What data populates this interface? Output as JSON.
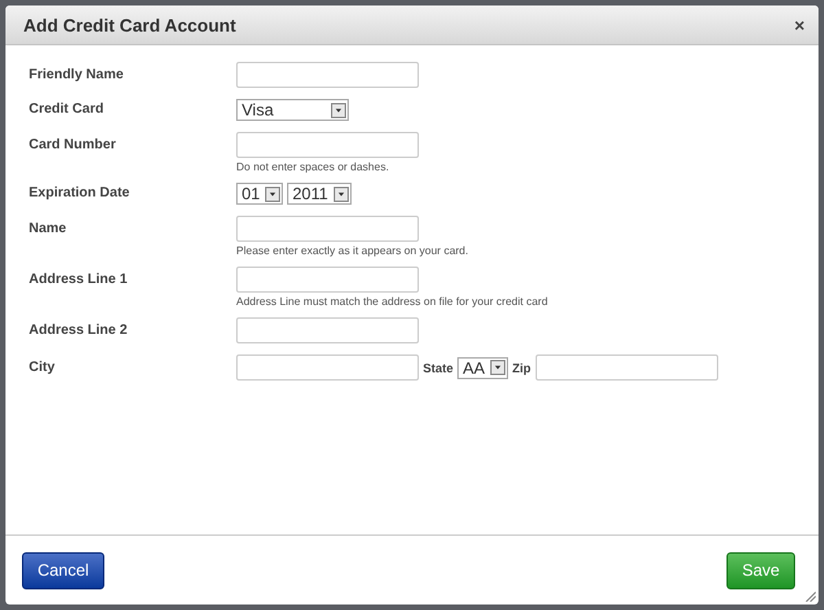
{
  "dialog": {
    "title": "Add Credit Card Account",
    "close": "×"
  },
  "fields": [
    {
      "kind": "text",
      "label": "Friendly Name"
    },
    {
      "kind": "select",
      "label": "Credit Card",
      "value": "Visa"
    },
    {
      "kind": "text",
      "label": "Card Number",
      "hint": "Do not enter spaces or dashes."
    },
    {
      "kind": "date",
      "label": "Expiration Date",
      "month": "01",
      "year": "2011"
    },
    {
      "kind": "text",
      "label": "Name",
      "hint": "Please enter exactly as it appears on your card."
    },
    {
      "kind": "text",
      "label": "Address Line 1",
      "hint": "Address Line must match the address on file for your credit card"
    },
    {
      "kind": "text",
      "label": "Address Line 2"
    },
    {
      "kind": "city",
      "label": "City",
      "state_label": "State",
      "state": "AA",
      "zip_label": "Zip"
    }
  ],
  "buttons": {
    "cancel": "Cancel",
    "save": "Save"
  }
}
